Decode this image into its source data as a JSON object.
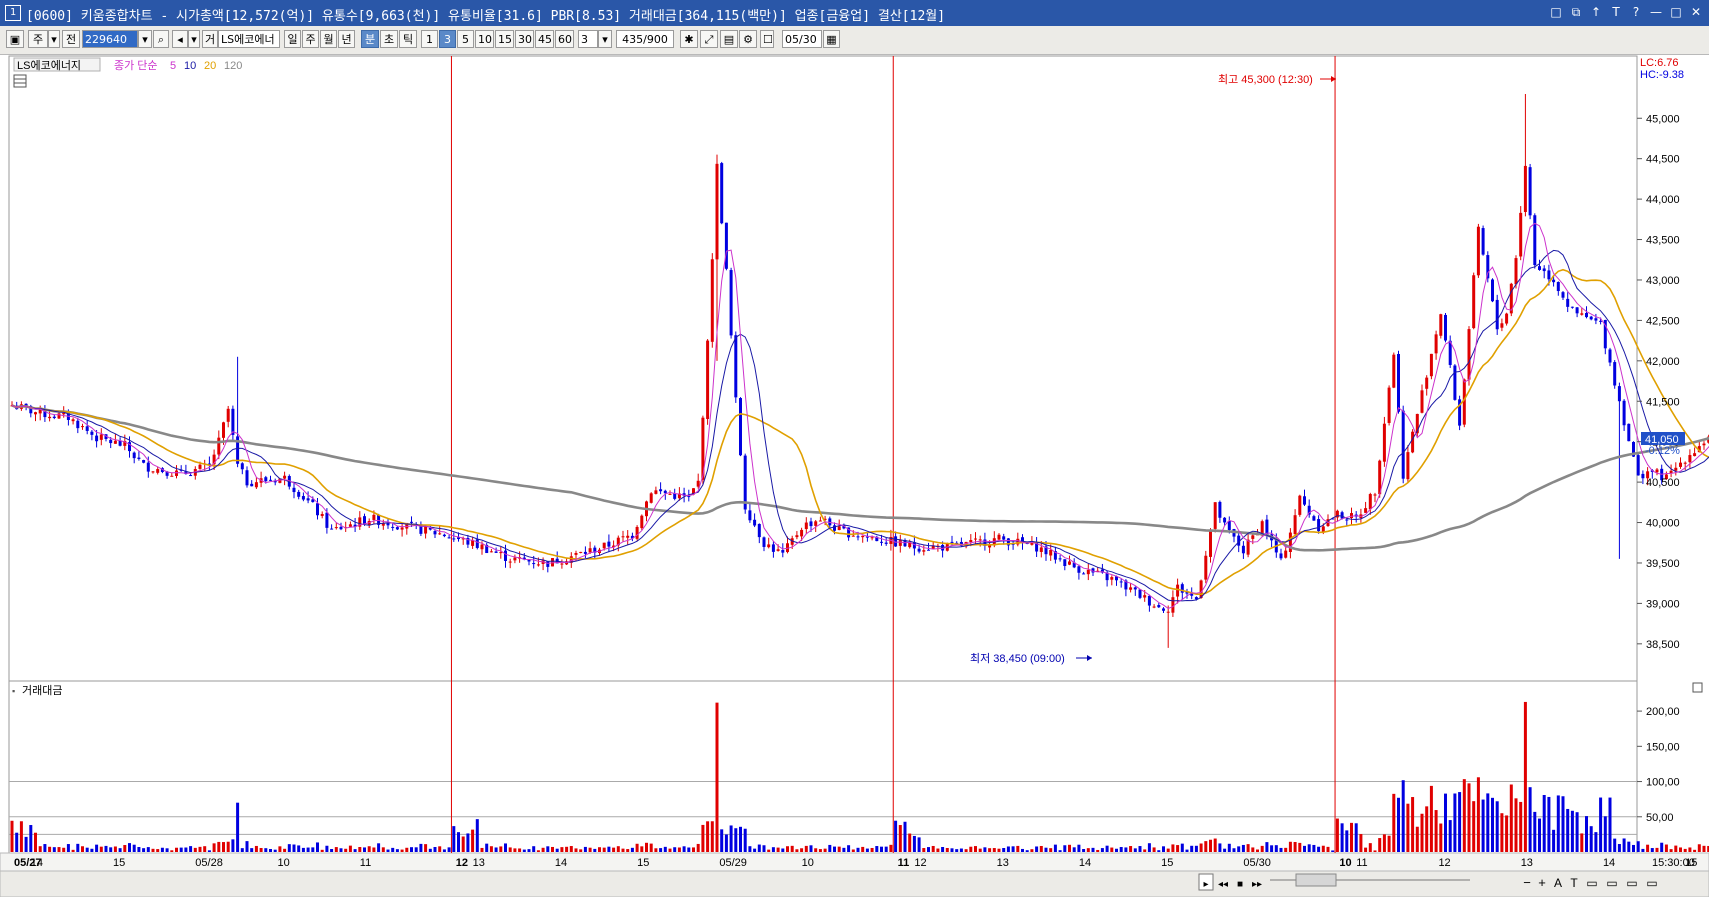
{
  "window": {
    "title": "[0600] 키움종합차트 - 시가총액[12,572(억)] 유통수[9,663(천)] 유통비율[31.6] PBR[8.53] 거래대금[364,115(백만)] 업종[금융업] 결산[12월]",
    "icon_label": "1",
    "buttons": [
      "□",
      "⧉",
      "↑",
      "T",
      "?",
      "—",
      "□",
      "✕"
    ]
  },
  "toolbar": {
    "type_label": "주",
    "prev_label": "전",
    "code_value": "229640",
    "gear_label": "거",
    "name_value": "LS에코에너",
    "periods": [
      "일",
      "주",
      "월",
      "년",
      "분",
      "초",
      "틱"
    ],
    "active_period": "분",
    "intervals": [
      "1",
      "3",
      "5",
      "10",
      "15",
      "30",
      "45",
      "60"
    ],
    "active_interval": "3",
    "count_value": "3",
    "range_value": "435/900",
    "date_value": "05/30"
  },
  "price_panel": {
    "stock_label": "LS에코에너지",
    "ma_title": "종가 단순",
    "ma_periods": [
      {
        "label": "5",
        "color": "#cc33cc"
      },
      {
        "label": "10",
        "color": "#1a1aa6"
      },
      {
        "label": "20",
        "color": "#e0a000"
      },
      {
        "label": "120",
        "color": "#888888"
      }
    ],
    "lc_label": "LC:6.76",
    "hc_label": "HC:-9.38",
    "current_price": "41,050",
    "current_change": "-0.12%",
    "high_annotation": "최고 45,300 (12:30)",
    "low_annotation": "최저 38,450 (09:00)",
    "y_ticks": [
      "45,000",
      "44,500",
      "44,000",
      "43,500",
      "43,000",
      "42,500",
      "42,000",
      "41,500",
      "41,000",
      "40,500",
      "40,000",
      "39,500",
      "39,000",
      "38,500"
    ]
  },
  "volume_panel": {
    "title": "거래대금",
    "y_ticks": [
      "200,00",
      "150,00",
      "100,00",
      "50,00"
    ],
    "time_label": "15:30:00"
  },
  "x_axis": {
    "labels": [
      "05/27",
      "14",
      "15",
      "05/28",
      "10",
      "11",
      "12",
      "13",
      "14",
      "15",
      "05/29",
      "10",
      "11",
      "12",
      "13",
      "14",
      "15",
      "05/30",
      "10",
      "11",
      "12",
      "13",
      "14",
      "15"
    ]
  },
  "nav_controls": [
    "▸",
    "◂◂",
    "■",
    "▸▸",
    "−",
    "+",
    "A",
    "T",
    "▭",
    "▭",
    "▭",
    "▭"
  ],
  "colors": {
    "up": "#e00000",
    "down": "#0000e0",
    "ma5": "#cc33cc",
    "ma10": "#1a1aa6",
    "ma20": "#e0a000",
    "ma120": "#888888",
    "divider": "#e00000",
    "title_bg": "#2a57a8"
  },
  "chart_data": {
    "type": "candlestick",
    "interval_minutes": 3,
    "sessions": [
      "05/27",
      "05/28",
      "05/29",
      "05/30"
    ],
    "price_ylim": [
      38300,
      45300
    ],
    "volume_ylim": [
      0,
      220
    ],
    "anchors": [
      {
        "session": "05/27",
        "open": 41500,
        "close": 40900
      },
      {
        "session": "05/28",
        "open": 41400,
        "low": 39400,
        "close": 40000
      },
      {
        "session": "05/29",
        "high": 44500,
        "low": 39550,
        "close": 39700
      },
      {
        "session": "05/30",
        "open": 38900,
        "high": 45300,
        "low": 38450,
        "close": 41050
      }
    ],
    "price_path": [
      [
        0,
        41450
      ],
      [
        6,
        41350
      ],
      [
        12,
        41300
      ],
      [
        18,
        41050
      ],
      [
        24,
        40950
      ],
      [
        28,
        40700
      ],
      [
        36,
        40600
      ],
      [
        42,
        40700
      ],
      [
        44,
        41000
      ],
      [
        46,
        41400
      ],
      [
        48,
        40700
      ],
      [
        50,
        40500
      ],
      [
        58,
        40550
      ],
      [
        64,
        40200
      ],
      [
        68,
        39900
      ],
      [
        76,
        40050
      ],
      [
        84,
        39950
      ],
      [
        92,
        39850
      ],
      [
        100,
        39700
      ],
      [
        106,
        39550
      ],
      [
        114,
        39500
      ],
      [
        120,
        39600
      ],
      [
        126,
        39700
      ],
      [
        132,
        39850
      ],
      [
        136,
        40400
      ],
      [
        140,
        40350
      ],
      [
        144,
        40300
      ],
      [
        146,
        40500
      ],
      [
        148,
        42200
      ],
      [
        150,
        44400
      ],
      [
        152,
        43100
      ],
      [
        154,
        41500
      ],
      [
        156,
        40200
      ],
      [
        160,
        39750
      ],
      [
        164,
        39600
      ],
      [
        168,
        39950
      ],
      [
        172,
        40050
      ],
      [
        176,
        39900
      ],
      [
        184,
        39800
      ],
      [
        192,
        39700
      ],
      [
        200,
        39700
      ],
      [
        210,
        39800
      ],
      [
        218,
        39700
      ],
      [
        226,
        39450
      ],
      [
        234,
        39300
      ],
      [
        240,
        39100
      ],
      [
        244,
        38950
      ],
      [
        246,
        38950
      ],
      [
        248,
        39200
      ],
      [
        252,
        39050
      ],
      [
        256,
        40200
      ],
      [
        258,
        39950
      ],
      [
        262,
        39650
      ],
      [
        266,
        40000
      ],
      [
        270,
        39500
      ],
      [
        274,
        40300
      ],
      [
        278,
        39950
      ],
      [
        282,
        40100
      ],
      [
        286,
        40050
      ],
      [
        290,
        40400
      ],
      [
        294,
        42100
      ],
      [
        296,
        40600
      ],
      [
        300,
        41600
      ],
      [
        304,
        42600
      ],
      [
        308,
        41200
      ],
      [
        312,
        43600
      ],
      [
        316,
        42400
      ],
      [
        318,
        42600
      ],
      [
        320,
        43300
      ],
      [
        322,
        44400
      ],
      [
        324,
        43200
      ],
      [
        328,
        43000
      ],
      [
        332,
        42600
      ],
      [
        338,
        42450
      ],
      [
        342,
        41500
      ],
      [
        346,
        40550
      ],
      [
        348,
        40650
      ],
      [
        352,
        40550
      ],
      [
        356,
        40800
      ],
      [
        360,
        41000
      ],
      [
        364,
        41300
      ],
      [
        368,
        41450
      ],
      [
        372,
        41100
      ],
      [
        374,
        40900
      ]
    ],
    "volume_spikes": [
      {
        "session": "05/28",
        "bar": 48,
        "value": 70
      },
      {
        "session": "05/29",
        "bar": 150,
        "value": 212
      },
      {
        "session": "05/30",
        "bar": 322,
        "value": 213
      }
    ]
  }
}
